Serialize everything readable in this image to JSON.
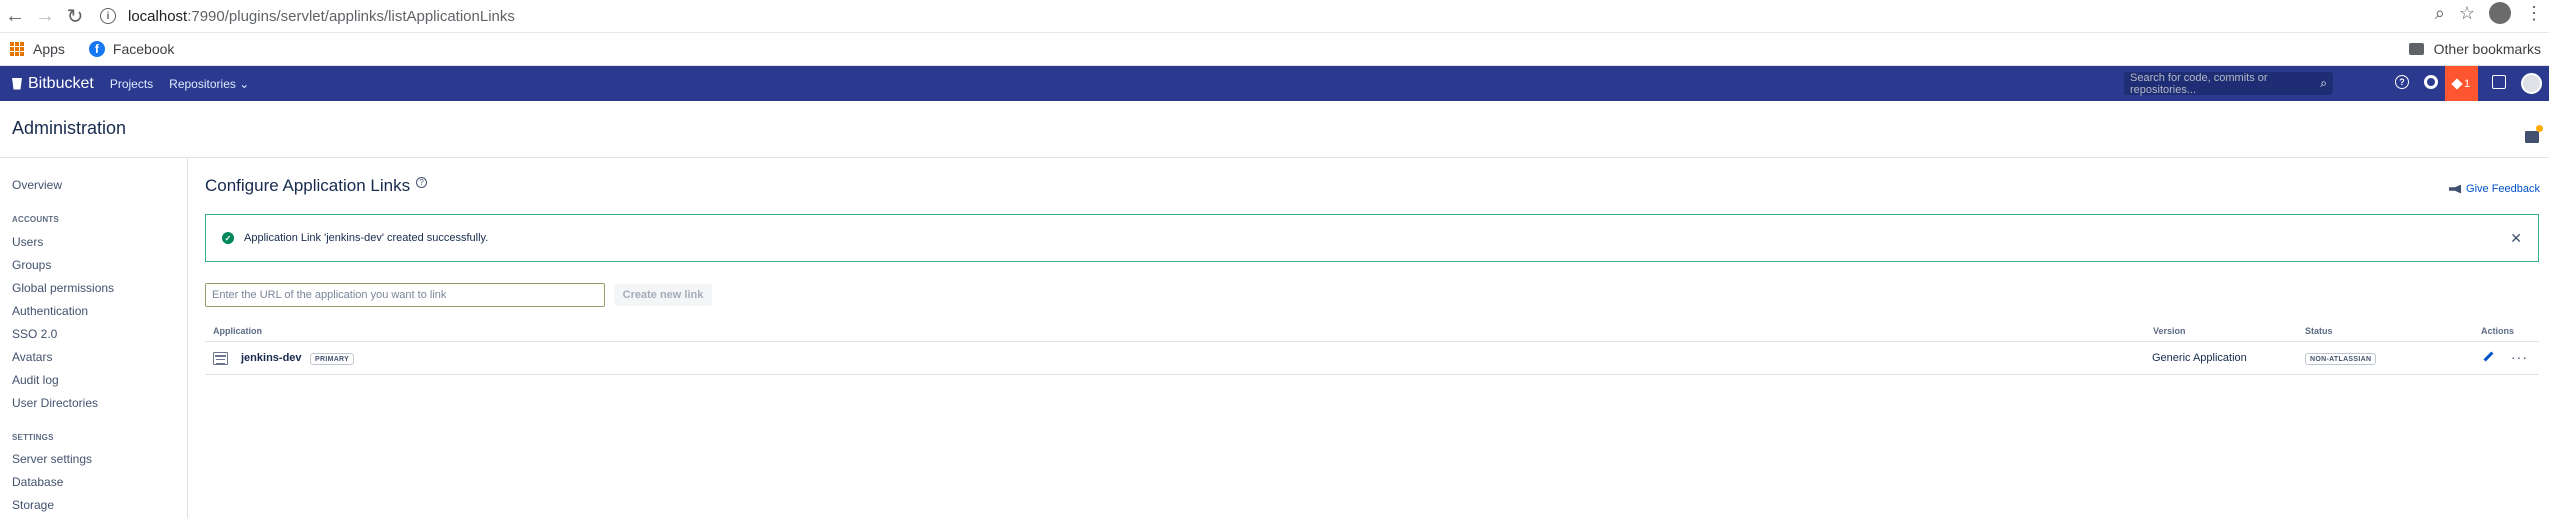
{
  "browser": {
    "url_host": "localhost",
    "url_path": ":7990/plugins/servlet/applinks/listApplicationLinks",
    "bookmarks": [
      {
        "label": "Apps"
      },
      {
        "label": "Facebook"
      }
    ],
    "other_bookmarks": "Other bookmarks"
  },
  "header": {
    "brand": "Bitbucket",
    "nav": [
      "Projects",
      "Repositories ⌄"
    ],
    "search_placeholder": "Search for code, commits or repositories...",
    "notification_count": "1",
    "brand_color": "#2b3a8f"
  },
  "page": {
    "title": "Administration"
  },
  "sidebar": {
    "overview": "Overview",
    "accounts_heading": "ACCOUNTS",
    "accounts": [
      "Users",
      "Groups",
      "Global permissions",
      "Authentication",
      "SSO 2.0",
      "Avatars",
      "Audit log",
      "User Directories"
    ],
    "settings_heading": "SETTINGS",
    "settings": [
      "Server settings",
      "Database",
      "Storage"
    ]
  },
  "main": {
    "title": "Configure Application Links",
    "give_feedback": "Give Feedback",
    "success_message": "Application Link 'jenkins-dev' created successfully.",
    "url_placeholder": "Enter the URL of the application you want to link",
    "create_button": "Create new link",
    "table": {
      "headers": {
        "application": "Application",
        "version": "Version",
        "status": "Status",
        "actions": "Actions"
      },
      "rows": [
        {
          "name": "jenkins-dev",
          "badge": "PRIMARY",
          "version": "Generic Application",
          "status": "NON-ATLASSIAN"
        }
      ]
    }
  }
}
